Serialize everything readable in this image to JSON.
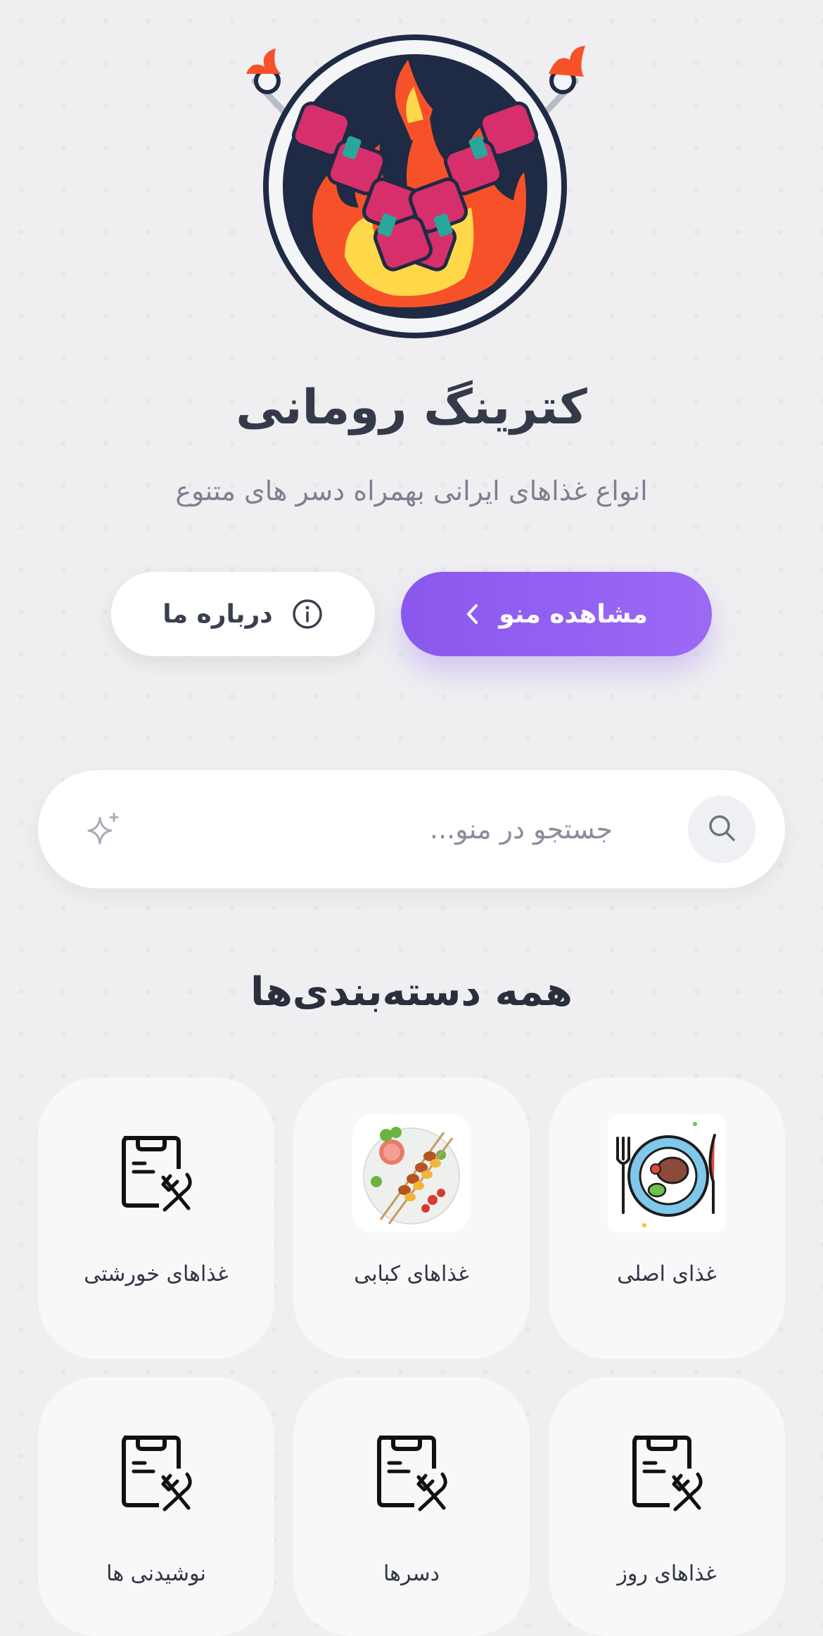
{
  "brand": {
    "title": "کترینگ رومانی",
    "subtitle": "انواع غذاهای ایرانی بهمراه دسر های متنوع"
  },
  "hero_buttons": {
    "menu_label": "مشاهده منو",
    "about_label": "درباره ما"
  },
  "search": {
    "placeholder": "جستجو در منو...",
    "value": ""
  },
  "categories": {
    "title": "همه دسته‌بندی‌ها",
    "items": [
      {
        "label": "غذای اصلی",
        "icon": "plate-steak-icon"
      },
      {
        "label": "غذاهای کبابی",
        "icon": "kebab-plate-icon"
      },
      {
        "label": "غذاهای خورشتی",
        "icon": "menu-cutlery-icon"
      },
      {
        "label": "غذاهای روز",
        "icon": "menu-cutlery-icon"
      },
      {
        "label": "دسرها",
        "icon": "menu-cutlery-icon"
      },
      {
        "label": "نوشیدنی ها",
        "icon": "menu-cutlery-icon"
      }
    ]
  },
  "colors": {
    "accent": "#8b5cf6",
    "background": "#efeff1",
    "card": "#f8f8f9",
    "text": "#2f3443"
  }
}
